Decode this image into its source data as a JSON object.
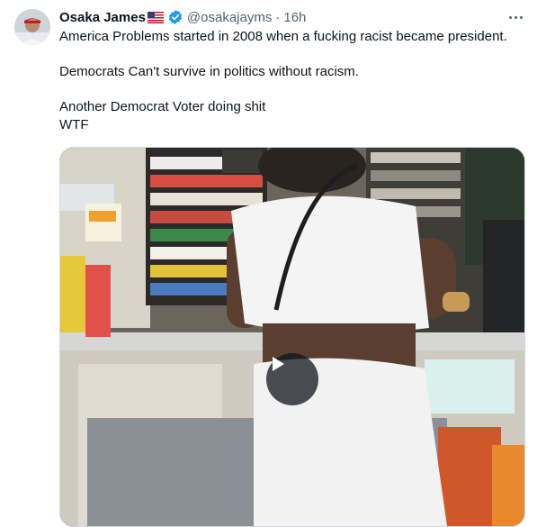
{
  "tweet": {
    "author_name": "Osaka James",
    "handle": "@osakajayms",
    "separator": "·",
    "time": "16h",
    "lines": [
      "America Problems started in 2008 when a fucking racist became president.",
      "",
      "Democrats Can't survive in politics without racism.",
      "",
      "Another Democrat Voter doing shit",
      "WTF"
    ]
  },
  "icons": {
    "flag": "us-flag-icon",
    "verified": "verified-badge-icon",
    "more": "more-options-icon",
    "play": "play-icon"
  },
  "colors": {
    "accent": "#1d9bf0",
    "text": "#0f1419",
    "secondary": "#536471"
  }
}
